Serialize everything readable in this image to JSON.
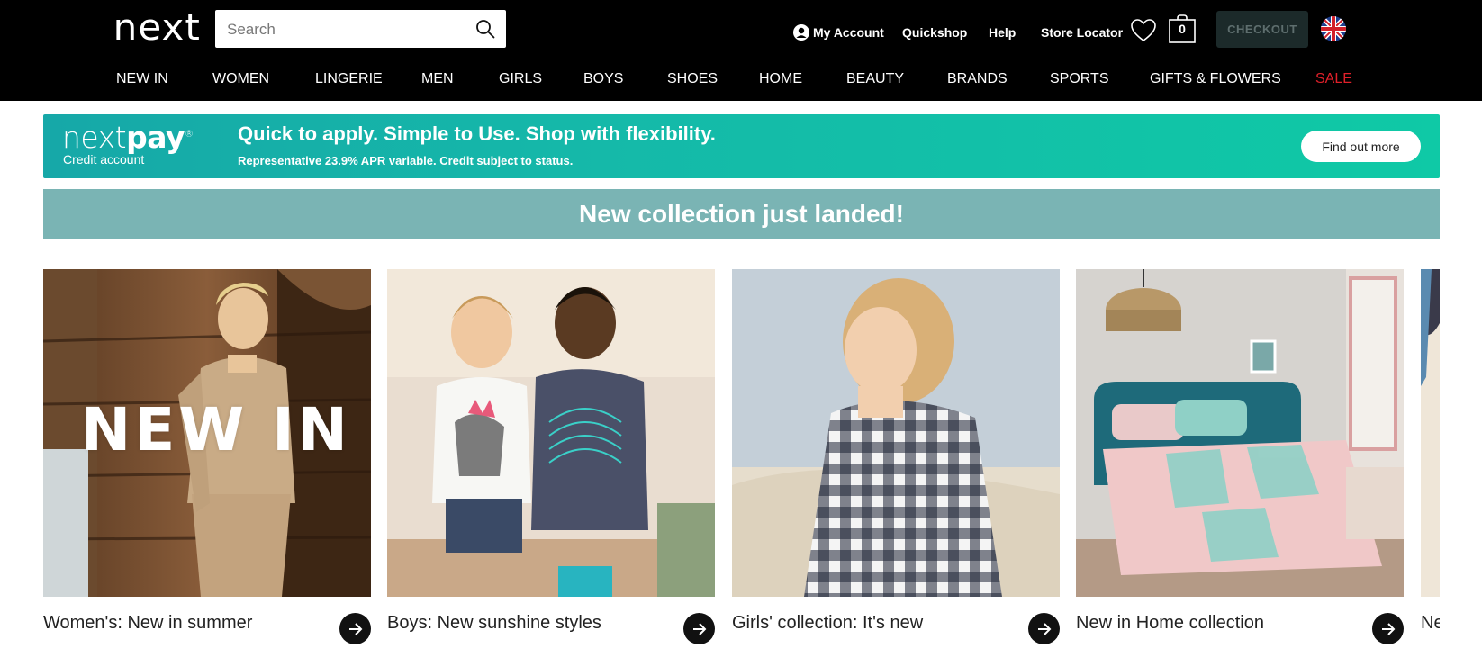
{
  "header": {
    "logo": "next",
    "search": {
      "placeholder": "Search",
      "value": ""
    },
    "links": {
      "my_account": "My Account",
      "quickshop": "Quickshop",
      "help": "Help",
      "store_locator": "Store Locator"
    },
    "bag_count": "0",
    "checkout_label": "CHECKOUT",
    "flag_icon": "uk-flag-icon"
  },
  "nav": [
    "NEW IN",
    "WOMEN",
    "LINGERIE",
    "MEN",
    "GIRLS",
    "BOYS",
    "SHOES",
    "HOME",
    "BEAUTY",
    "BRANDS",
    "SPORTS",
    "GIFTS & FLOWERS",
    "SALE"
  ],
  "nextpay": {
    "logo_light": "next",
    "logo_bold": "pay",
    "sub": "Credit account",
    "headline": "Quick to apply. Simple to Use. Shop with flexibility.",
    "small": "Representative 23.9% APR variable. Credit subject to status.",
    "button": "Find out more"
  },
  "collection_banner": "New collection just landed!",
  "cards": [
    {
      "title": "Women's: New in summer",
      "overlay": "NEW IN"
    },
    {
      "title": "Boys: New sunshine styles"
    },
    {
      "title": "Girls' collection: It's new"
    },
    {
      "title": "New in Home collection"
    },
    {
      "title": "Ne"
    }
  ],
  "colors": {
    "header_bg": "#000000",
    "sale_red": "#e0202a",
    "nextpay_teal": "#0fc9a6",
    "collection_bar": "#7ab4b4"
  }
}
